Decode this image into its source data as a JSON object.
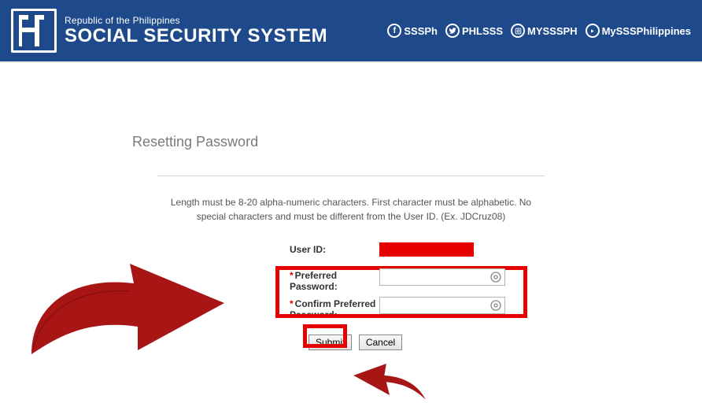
{
  "header": {
    "subtitle": "Republic of the Philippines",
    "title": "SOCIAL SECURITY SYSTEM",
    "socials": [
      {
        "icon": "f",
        "label": "SSSPh"
      },
      {
        "icon": "t",
        "label": "PHLSSS"
      },
      {
        "icon": "ig",
        "label": "MYSSSPH"
      },
      {
        "icon": "yt",
        "label": "MySSSPhilippines"
      }
    ]
  },
  "page": {
    "heading": "Resetting Password",
    "instructions": "Length must be 8-20 alpha-numeric characters. First character must be alphabetic. No special characters and must be different from the User ID. (Ex. JDCruz08)"
  },
  "form": {
    "userid_label": "User ID:",
    "preferred_label": "Preferred Password:",
    "confirm_label": "Confirm Preferred Password:",
    "preferred_value": "",
    "confirm_value": "",
    "submit": "Submit",
    "cancel": "Cancel"
  }
}
